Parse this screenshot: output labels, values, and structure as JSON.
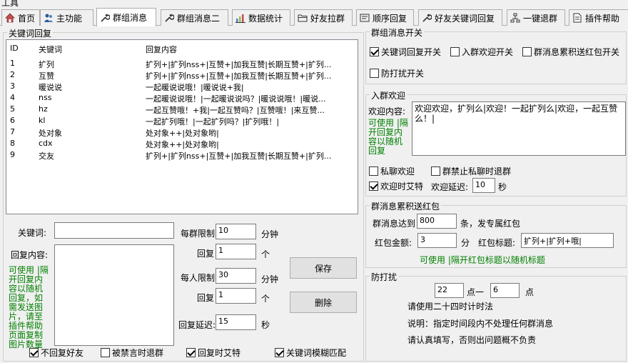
{
  "window": {
    "title": "工具"
  },
  "tabs": [
    {
      "label": "首页",
      "icon": "home-icon"
    },
    {
      "label": "主功能",
      "icon": "people-icon"
    },
    {
      "label": "群组消息",
      "icon": "wrench-icon"
    },
    {
      "label": "群组消息二",
      "icon": "wrench-icon"
    },
    {
      "label": "数据统计",
      "icon": "bar-chart-icon"
    },
    {
      "label": "好友拉群",
      "icon": "folder-icon"
    },
    {
      "label": "顺序回复",
      "icon": "card-icon"
    },
    {
      "label": "好友关键词回复",
      "icon": "wrench-icon"
    },
    {
      "label": "一键退群",
      "icon": "tree-icon"
    },
    {
      "label": "插件帮助",
      "icon": "document-icon"
    }
  ],
  "keyword_group": {
    "title": "关键词回复",
    "columns": [
      "ID",
      "关键词",
      "回复内容"
    ],
    "rows": [
      {
        "id": "1",
        "kw": "扩列",
        "reply": "扩列+|扩列nss+|互赞+|加我互赞|长期互赞+|扩列..."
      },
      {
        "id": "2",
        "kw": "互赞",
        "reply": "扩列+|扩列nss+|互赞+|加我互赞|长期互赞+|扩列..."
      },
      {
        "id": "3",
        "kw": "暖说说",
        "reply": "一起暖说说哦！|暖说说+我|"
      },
      {
        "id": "4",
        "kw": "nss",
        "reply": "一起暖说说哦！|一起暖说说吗？|暖说说哦！|暖说..."
      },
      {
        "id": "5",
        "kw": "hz",
        "reply": "一起互赞哦！+我|一起互赞吗？|互赞哦！|来互赞..."
      },
      {
        "id": "6",
        "kw": "kl",
        "reply": "一起扩列哦！|一起扩列吗？|扩列哦！|"
      },
      {
        "id": "7",
        "kw": "处对象",
        "reply": "处对象++|处对象哟|"
      },
      {
        "id": "8",
        "kw": "cdx",
        "reply": "处对象++|处对象哟|"
      },
      {
        "id": "9",
        "kw": "交友",
        "reply": "扩列+|扩列nss+|互赞+|加我互赞|长期互赞+|扩列..."
      }
    ]
  },
  "form": {
    "keyword_label": "关键词:",
    "keyword_value": "",
    "reply_label": "回复内容:",
    "reply_value": "",
    "hint": "可使用 |隔\n开回复内\n容以随机\n回复，如\n需发送图\n片，请至\n插件帮助\n页面复制\n图片数量",
    "per_group_label": "每群限制",
    "per_group_value": "10",
    "per_group_unit": "分钟",
    "reply1_label": "回复",
    "reply1_value": "1",
    "reply1_unit": "个",
    "per_person_label": "每人限制",
    "per_person_value": "30",
    "per_person_unit": "分钟",
    "reply2_label": "回复",
    "reply2_value": "1",
    "reply2_unit": "个",
    "delay_label": "回复延迟:",
    "delay_value": "15",
    "delay_unit": "秒",
    "save_label": "保存",
    "delete_label": "删除",
    "checks": [
      {
        "label": "不回复好友",
        "checked": true
      },
      {
        "label": "被禁言时退群",
        "checked": false
      },
      {
        "label": "回复时艾特",
        "checked": true
      },
      {
        "label": "关键词模糊匹配",
        "checked": true
      }
    ]
  },
  "switch_group": {
    "title": "群组消息开关",
    "checks": [
      {
        "label": "关键词回复开关",
        "checked": true
      },
      {
        "label": "入群欢迎开关",
        "checked": false
      },
      {
        "label": "群消息累积送红包开关",
        "checked": false
      },
      {
        "label": "防打扰开关",
        "checked": false
      }
    ]
  },
  "welcome_group": {
    "title": "入群欢迎",
    "content_label": "欢迎内容:",
    "content_value": "欢迎欢迎，扩列么|欢迎！一起扩列么|欢迎，一起互赞么！|",
    "hint": "可使用 |隔\n开回复内\n容以随机\n回复",
    "private_label": "私聊欢迎",
    "private_checked": false,
    "exit_label": "群禁止私聊时退群",
    "exit_checked": false,
    "at_label": "欢迎时艾特",
    "at_checked": true,
    "delay_label": "欢迎延迟:",
    "delay_value": "10",
    "delay_unit": "秒"
  },
  "redpacket_group": {
    "title": "群消息累积送红包",
    "reach_label": "群消息达到",
    "reach_value": "800",
    "reach_unit": "条，发专属红包",
    "amount_label": "红包金额:",
    "amount_value": "3",
    "amount_unit": "分",
    "title_label": "红包标题:",
    "title_value": "扩列+|扩列+哦|",
    "hint": "可使用 |隔开红包标题以随机标题"
  },
  "dnd_group": {
    "title": "防打扰",
    "start_value": "22",
    "mid_label": "点一",
    "end_value": "6",
    "end_label": "点",
    "line1": "请使用二十四时计时法",
    "line2": "说明：指定时间段内不处理任何群消息",
    "line3": "请认真填写，否则出问题概不负责"
  }
}
